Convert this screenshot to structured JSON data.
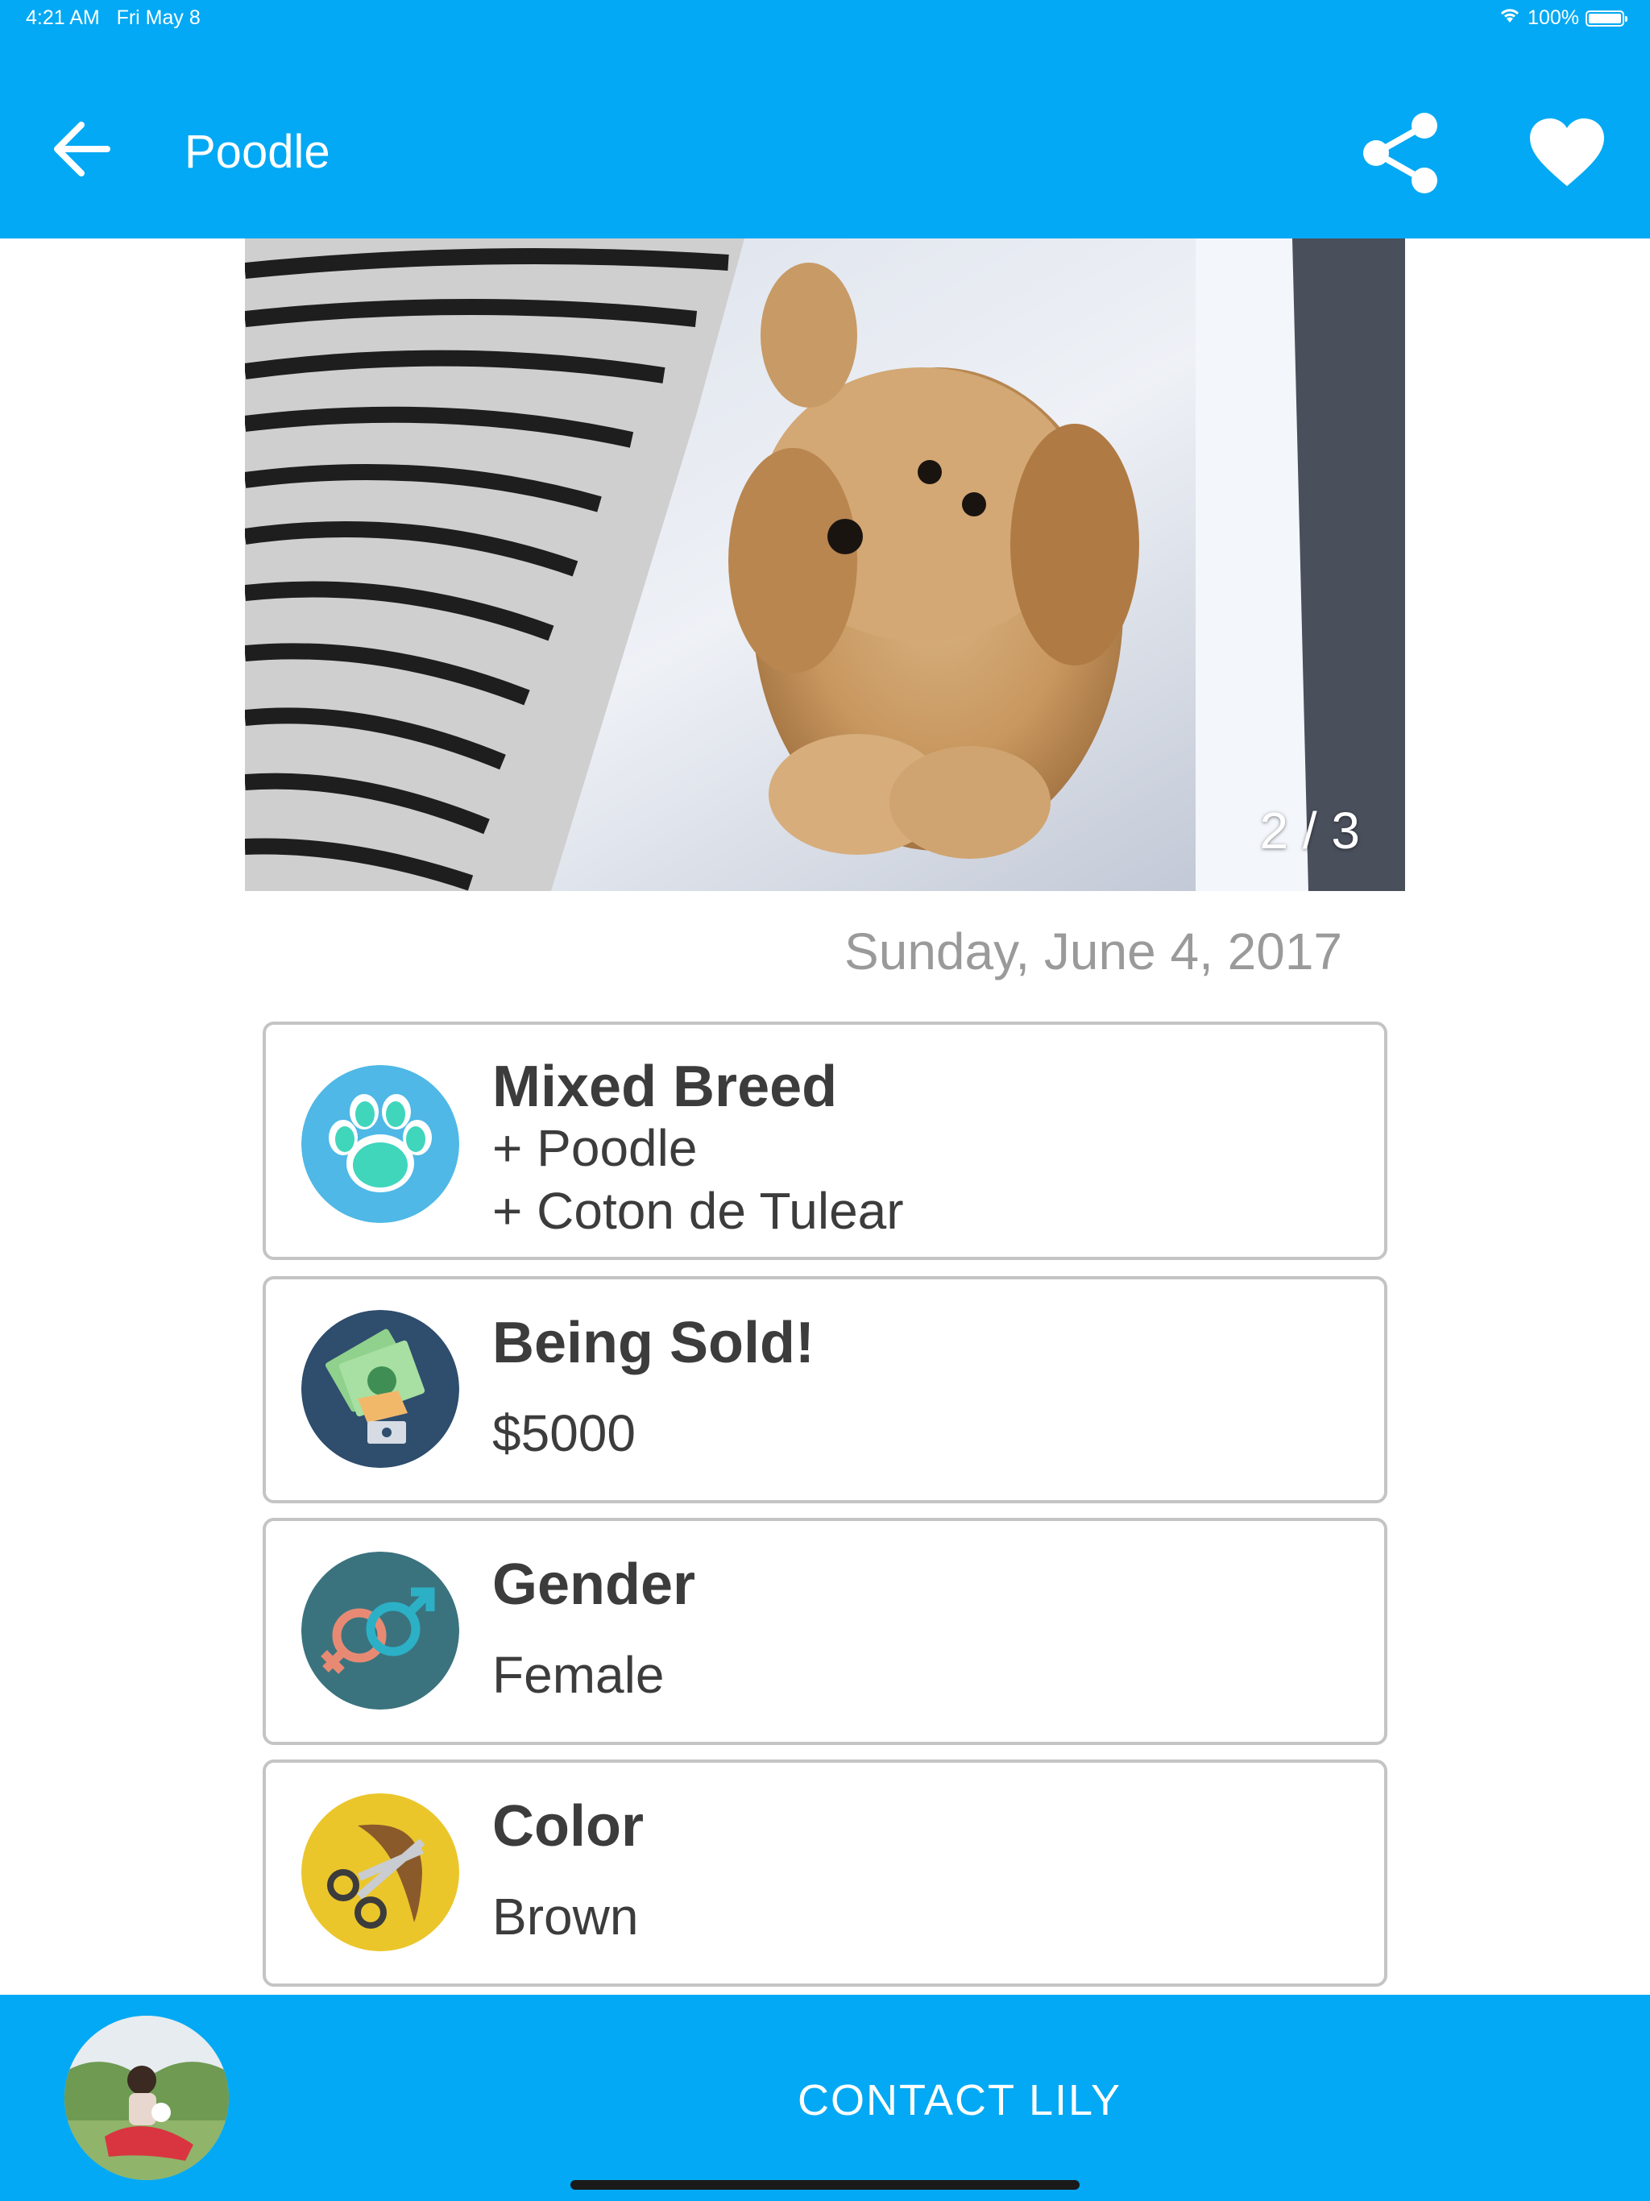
{
  "status_bar": {
    "time": "4:21 AM",
    "date": "Fri May 8",
    "battery": "100%",
    "icons": [
      "wifi-icon",
      "battery-icon"
    ]
  },
  "app_bar": {
    "title": "Poodle",
    "back_icon": "arrow-left-icon",
    "share_icon": "share-icon",
    "favorite_icon": "heart-icon"
  },
  "gallery": {
    "counter": "2 / 3",
    "current": 2,
    "total": 3
  },
  "post_date": "Sunday, June 4, 2017",
  "details": [
    {
      "icon": "paw-icon",
      "label": "Mixed Breed",
      "values": [
        "+ Poodle",
        "+ Coton de Tulear"
      ]
    },
    {
      "icon": "money-hand-icon",
      "label": "Being Sold!",
      "values": [
        "$5000"
      ]
    },
    {
      "icon": "gender-icon",
      "label": "Gender",
      "values": [
        "Female"
      ]
    },
    {
      "icon": "scissors-icon",
      "label": "Color",
      "values": [
        "Brown"
      ]
    }
  ],
  "bottom_bar": {
    "contact_label": "CONTACT LILY"
  },
  "colors": {
    "primary": "#03a9f4",
    "text": "#3c3c3c",
    "muted": "#9a9a9a",
    "card_border": "#c4c4c4"
  }
}
